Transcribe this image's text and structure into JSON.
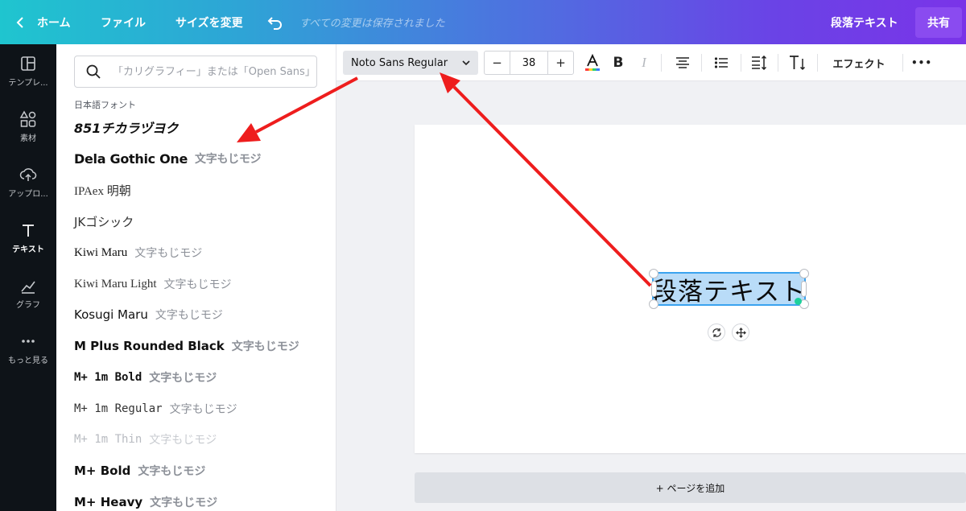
{
  "topbar": {
    "home": "ホーム",
    "file": "ファイル",
    "resize": "サイズを変更",
    "saved_status": "すべての変更は保存されました",
    "doc_title": "段落テキスト",
    "share": "共有"
  },
  "leftnav": {
    "items": [
      {
        "label": "テンプレ...",
        "icon": "template-icon"
      },
      {
        "label": "素材",
        "icon": "elements-icon"
      },
      {
        "label": "アップロ...",
        "icon": "upload-icon"
      },
      {
        "label": "テキスト",
        "icon": "text-icon"
      },
      {
        "label": "グラフ",
        "icon": "chart-icon"
      },
      {
        "label": "もっと見る",
        "icon": "more-icon"
      }
    ]
  },
  "fontpanel": {
    "search_placeholder": "「カリグラフィー」または「Open Sans」",
    "section_label": "日本語フォント",
    "fonts": [
      {
        "name": "851チカラヅヨク",
        "sample": ""
      },
      {
        "name": "Dela Gothic One",
        "sample": "文字もじモジ"
      },
      {
        "name": "IPAex 明朝",
        "sample": ""
      },
      {
        "name": "JKゴシック",
        "sample": ""
      },
      {
        "name": "Kiwi Maru",
        "sample": "文字もじモジ"
      },
      {
        "name": "Kiwi Maru Light",
        "sample": "文字もじモジ"
      },
      {
        "name": "Kosugi Maru",
        "sample": "文字もじモジ"
      },
      {
        "name": "M Plus Rounded Black",
        "sample": "文字もじモジ"
      },
      {
        "name": "M+ 1m Bold",
        "sample": "文字もじモジ"
      },
      {
        "name": "M+ 1m Regular",
        "sample": "文字もじモジ"
      },
      {
        "name": "M+ 1m Thin",
        "sample": "文字もじモジ"
      },
      {
        "name": "M+ Bold",
        "sample": "文字もじモジ"
      },
      {
        "name": "M+ Heavy",
        "sample": "文字もじモジ"
      }
    ]
  },
  "toolbar": {
    "font_name": "Noto Sans Regular",
    "minus": "−",
    "font_size": "38",
    "plus": "+",
    "effect": "エフェクト",
    "more": "•••"
  },
  "canvas": {
    "text": "段落テキスト",
    "add_page": "+ ページを追加"
  },
  "colors": {
    "arrow": "#ee1d1d",
    "selection": "#3ba3ef",
    "share": "#8a4bf0"
  }
}
